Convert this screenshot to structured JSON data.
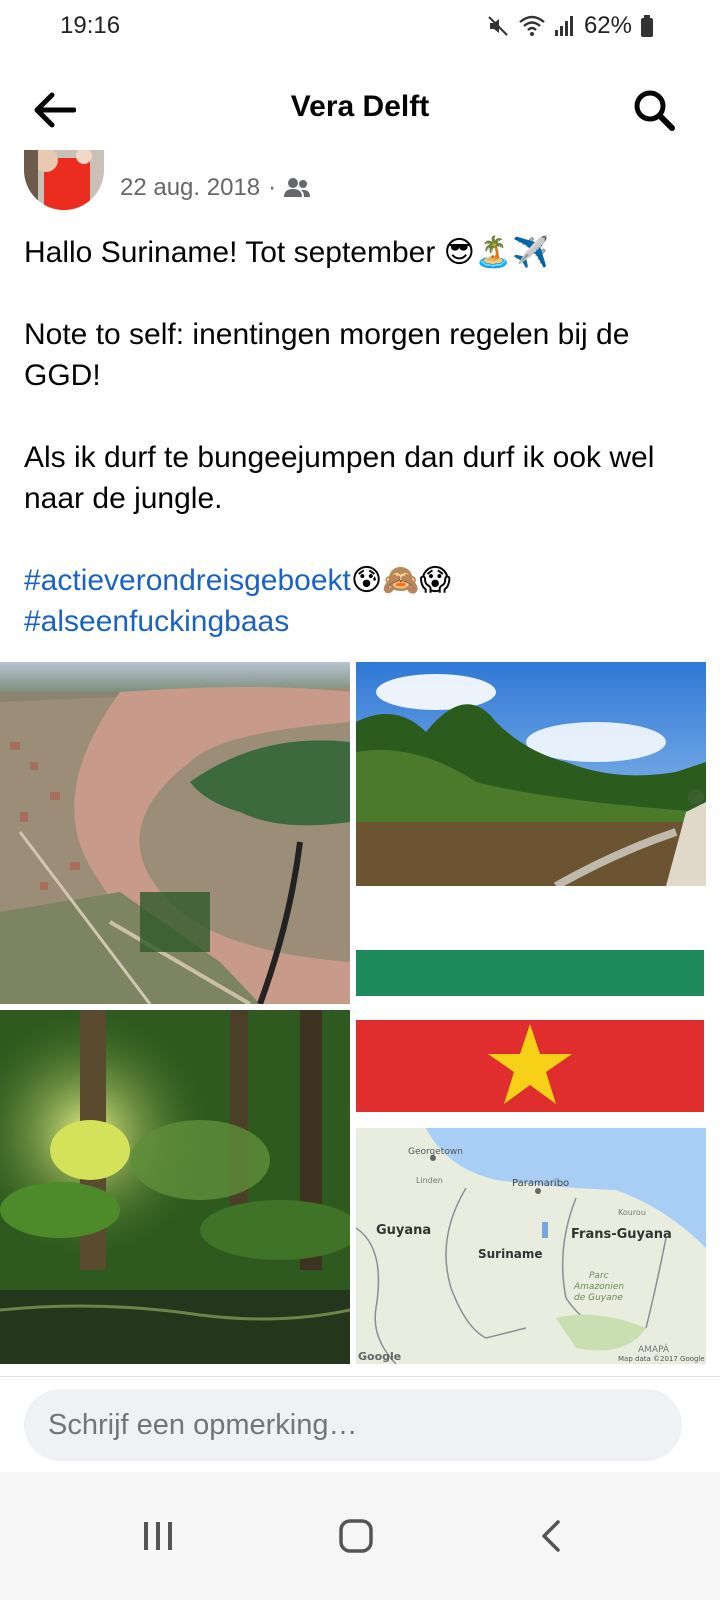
{
  "status_bar": {
    "time": "19:16",
    "battery": "62%",
    "icons": [
      "mute-icon",
      "wifi-icon",
      "signal-icon",
      "battery-icon"
    ]
  },
  "header": {
    "title": "Vera Delft",
    "back_icon": "arrow-left-icon",
    "search_icon": "search-icon"
  },
  "post": {
    "date": "22 aug. 2018",
    "separator": "·",
    "audience_icon": "friends-icon",
    "lines": [
      "Hallo Suriname! Tot september 😎🏝️✈️",
      "Note to self: inentingen morgen regelen bij de GGD!",
      "Als ik durf te bungeejumpen dan durf ik ook wel naar de jungle."
    ],
    "hashtags": [
      {
        "tag": "#actieverondreisgeboekt",
        "emoji": "😰🙈😱"
      },
      {
        "tag": "#alseenfuckingbaas",
        "emoji": ""
      }
    ],
    "photos": [
      "aerial-city-river-photo",
      "river-boat-jungle-photo",
      "suriname-flag-image",
      "rainforest-photo",
      "suriname-map-image"
    ],
    "map_labels": {
      "georgetown": "Georgetown",
      "linden": "Linden",
      "paramaribo": "Paramaribo",
      "kourou": "Kourou",
      "guyana": "Guyana",
      "suriname": "Suriname",
      "frans_guyana": "Frans-Guyana",
      "parc": "Parc",
      "amazonien": "Amazonien",
      "de_guyane": "de Guyane",
      "amapa": "AMAPÁ",
      "google": "Google",
      "map_data": "Map data ©2017 Google"
    }
  },
  "comment": {
    "placeholder": "Schrijf een opmerking…"
  },
  "nav": {
    "icons": [
      "recent-apps-icon",
      "home-icon",
      "back-icon"
    ]
  },
  "colors": {
    "hashtag": "#1b63c2",
    "flag_green": "#1c8a5a",
    "flag_red": "#e02d2d",
    "flag_star": "#f7d117",
    "map_sea": "#a9cef5",
    "map_land": "#e8eddf"
  }
}
